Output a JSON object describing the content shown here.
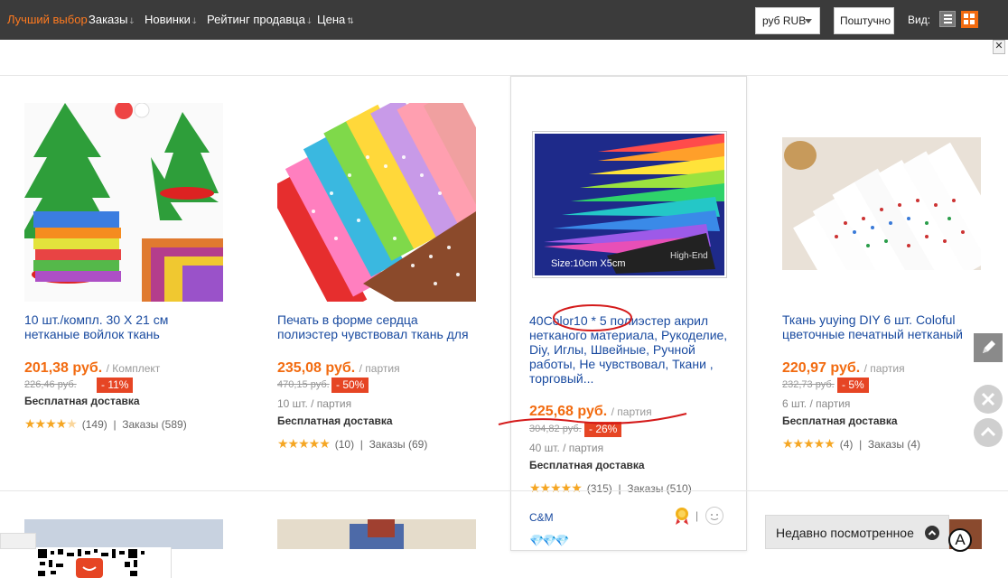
{
  "sortbar": {
    "best": "Лучший выбор",
    "orders": "Заказы",
    "new": "Новинки",
    "seller_rating": "Рейтинг продавца",
    "price": "Цена",
    "currency": "руб RUB",
    "per_piece": "Поштучно",
    "view": "Вид:"
  },
  "close_label": "✕",
  "products": [
    {
      "title": "10 шт./компл. 30 X 21 см нетканые войлок ткань",
      "price": "201,38 руб.",
      "unit": "/ Комплект",
      "old_price": "226,46 руб.",
      "discount": "- 11%",
      "lot": "",
      "shipping": "Бесплатная доставка",
      "stars": "★★★★",
      "half_star": "★",
      "reviews": "(149)",
      "orders": "Заказы (589)"
    },
    {
      "title": "Печать в форме сердца полиэстер чувствовал ткань для",
      "price": "235,08 руб.",
      "unit": "/ партия",
      "old_price": "470,15 руб.",
      "discount": "- 50%",
      "lot": "10 шт. / партия",
      "shipping": "Бесплатная доставка",
      "stars": "★★★★★",
      "reviews": "(10)",
      "orders": "Заказы (69)"
    },
    {
      "title": "40Color10 * 5 полиэстер акрил нетканого материала, Рукоделие, Diy, Иглы, Швейные, Ручной работы, Не чувствовал, Ткани , торговый...",
      "price": "225,68 руб.",
      "unit": "/ партия",
      "old_price": "304,82 руб.",
      "discount": "- 26%",
      "lot": "40 шт. / партия",
      "shipping": "Бесплатная доставка",
      "stars": "★★★★★",
      "reviews": "(315)",
      "orders": "Заказы (510)",
      "seller": "C&M",
      "diamonds": "💎💎💎",
      "image_caption": "Size:10cm X5cm",
      "image_brand": "High-End"
    },
    {
      "title": "Ткань yuying DIY 6 шт. Coloful цветочные печатный нетканый",
      "price": "220,97 руб.",
      "unit": "/ партия",
      "old_price": "232,73 руб.",
      "discount": "- 5%",
      "lot": "6 шт. / партия",
      "shipping": "Бесплатная доставка",
      "stars": "★★★★★",
      "reviews": "(4)",
      "orders": "Заказы (4)"
    }
  ],
  "recently_viewed": "Недавно посмотренное",
  "circle_letter": "A",
  "colors": {
    "accent": "#f26b10",
    "link": "#1a4ba0",
    "discount": "#e64524",
    "topbar": "#3b3b3b"
  }
}
